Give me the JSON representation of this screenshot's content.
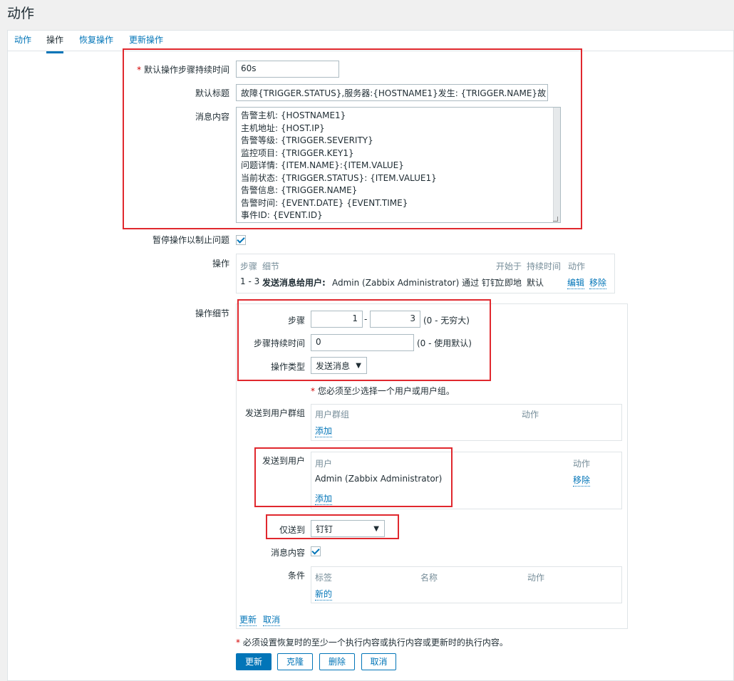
{
  "page": {
    "title": "动作"
  },
  "tabs": [
    {
      "label": "动作"
    },
    {
      "label": "操作"
    },
    {
      "label": "恢复操作"
    },
    {
      "label": "更新操作"
    }
  ],
  "form": {
    "duration_label": "默认操作步骤持续时间",
    "duration_value": "60s",
    "subject_label": "默认标题",
    "subject_value": "故障{TRIGGER.STATUS},服务器:{HOSTNAME1}发生: {TRIGGER.NAME}故",
    "message_label": "消息内容",
    "message_lines": [
      "告警主机: {HOSTNAME1}",
      "主机地址: {HOST.IP}",
      "告警等级: {TRIGGER.SEVERITY}",
      "监控项目: {TRIGGER.KEY1}",
      "问题详情: {ITEM.NAME}:{ITEM.VALUE}",
      "当前状态: {TRIGGER.STATUS}:  {ITEM.VALUE1}",
      "告警信息: {TRIGGER.NAME}",
      "告警时间: {EVENT.DATE}  {EVENT.TIME}",
      "事件ID: {EVENT.ID}"
    ],
    "pause_label": "暂停操作以制止问题",
    "pause_checked": true,
    "operations_label": "操作"
  },
  "operations_table": {
    "headers": {
      "steps": "步骤",
      "details": "细节",
      "start": "开始于",
      "duration": "持续时间",
      "action": "动作"
    },
    "row": {
      "steps": "1 - 3",
      "details_bold": "发送消息给用户:",
      "details_rest": "Admin (Zabbix Administrator) 通过 钉钉",
      "start": "立即地",
      "duration": "默认",
      "edit": "编辑",
      "remove": "移除"
    }
  },
  "op_details": {
    "label": "操作细节",
    "steps_label": "步骤",
    "step_from": "1",
    "step_dash": "-",
    "step_to": "3",
    "step_hint": "(0 - 无穷大)",
    "step_duration_label": "步骤持续时间",
    "step_duration_value": "0",
    "step_duration_hint": "(0 - 使用默认)",
    "op_type_label": "操作类型",
    "op_type_value": "发送消息",
    "required_note": "您必须至少选择一个用户或用户组。",
    "groups_label": "发送到用户群组",
    "groups_header_group": "用户群组",
    "groups_header_action": "动作",
    "groups_add": "添加",
    "users_label": "发送到用户",
    "users_header_user": "用户",
    "users_header_action": "动作",
    "user_row": "Admin (Zabbix Administrator)",
    "user_remove": "移除",
    "users_add": "添加",
    "send_only_label": "仅送到",
    "send_only_value": "钉钉",
    "default_message_label": "消息内容",
    "default_message_checked": true,
    "conditions_label": "条件",
    "cond_header_label": "标签",
    "cond_header_name": "名称",
    "cond_header_action": "动作",
    "cond_new": "新的",
    "update_link": "更新",
    "cancel_link": "取消"
  },
  "footer": {
    "note": "必须设置恢复时的至少一个执行内容或执行内容或更新时的执行内容。",
    "buttons": {
      "update": "更新",
      "clone": "克隆",
      "delete": "删除",
      "cancel": "取消"
    }
  },
  "colors": {
    "accent": "#0275b8",
    "highlight_box": "#e0282e",
    "required": "#d40000"
  }
}
